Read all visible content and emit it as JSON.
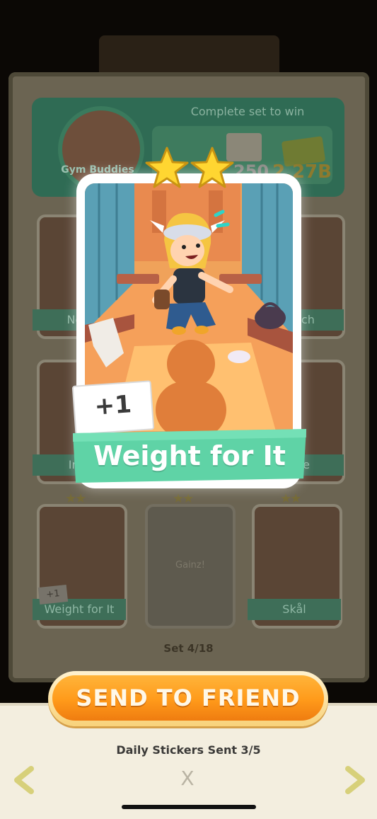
{
  "background_album": {
    "set_title": "Gym Buddies",
    "complete_set_label": "Complete set to win",
    "reward_dice": "250",
    "reward_cash": "2.27B",
    "cards": [
      {
        "label": "New"
      },
      {
        "label": "Coach"
      },
      {
        "label": "Imp"
      },
      {
        "label": "here"
      },
      {
        "label": "Weight for It"
      },
      {
        "label": "Gainz!"
      },
      {
        "label": "Skål"
      }
    ],
    "small_plus_tag": "+1",
    "set_progress": "Set 4/18"
  },
  "sticker": {
    "name": "Weight for It",
    "plus_tag": "+1",
    "stars": 2,
    "colors": {
      "card_border": "#ffffff",
      "banner": "#5fd3a6",
      "star": "#ffd631"
    }
  },
  "actions": {
    "send_button": "SEND TO FRIEND",
    "daily_sent_label": "Daily Stickers Sent 3/5",
    "close_symbol": "X",
    "prev_icon": "chevron-left-icon",
    "next_icon": "chevron-right-icon"
  },
  "colors": {
    "accent_orange": "#ff9a1a",
    "sheet_bg": "#f3eedf",
    "nav_arrow": "#d7d07a"
  }
}
